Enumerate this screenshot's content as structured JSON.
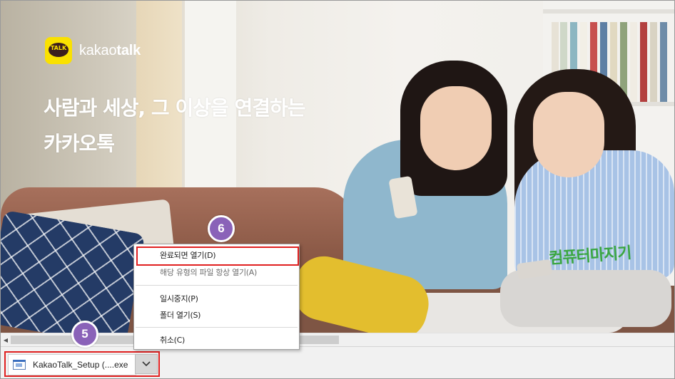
{
  "hero": {
    "brand_badge": "TALK",
    "brand_name_light": "kakao",
    "brand_name_bold": "talk",
    "headline_line1": "사람과 세상, 그 이상을 연결하는",
    "headline_line2": "카카오톡",
    "watermark": "컴퓨터마지기"
  },
  "download_bar": {
    "file_name": "KakaoTalk_Setup (....exe",
    "file_icon": "exe-file-icon",
    "menu_toggle_icon": "chevron-down-icon"
  },
  "context_menu": {
    "items": [
      {
        "label": "완료되면 열기(D)"
      },
      {
        "label": "해당 유형의 파일 항상 열기(A)"
      },
      {
        "label": "일시중지(P)"
      },
      {
        "label": "폴더 열기(S)"
      },
      {
        "label": "취소(C)"
      }
    ]
  },
  "badges": {
    "step5": "5",
    "step6": "6"
  },
  "colors": {
    "kakao_yellow": "#FAE100",
    "highlight_red": "#E02020",
    "badge_purple": "#8A62B8"
  }
}
